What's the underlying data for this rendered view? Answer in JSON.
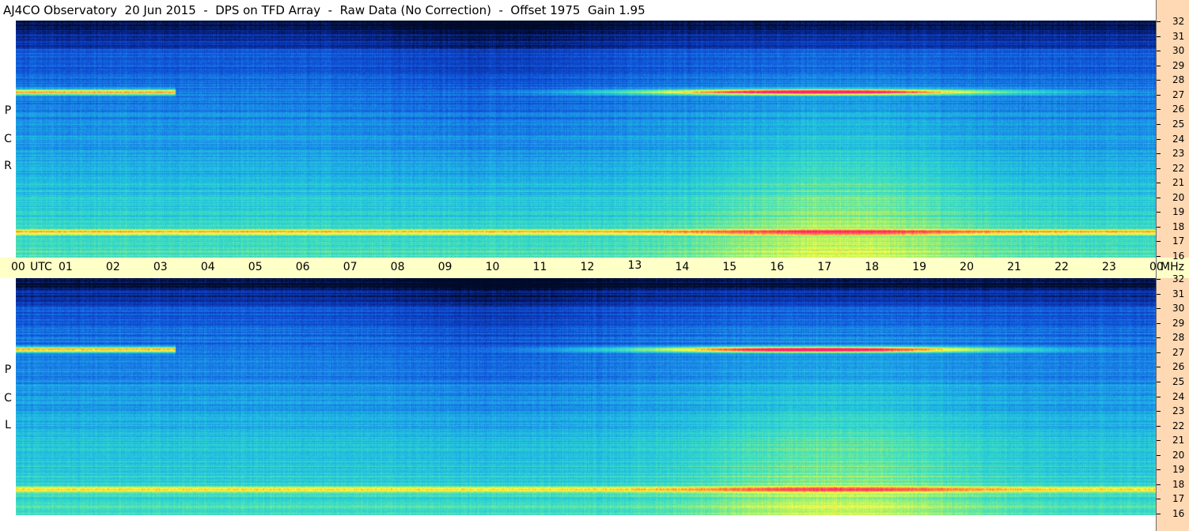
{
  "title": "AJ4CO Observatory  20 Jun 2015  -  DPS on TFD Array  -  Raw Data (No Correction)  -  Offset 1975  Gain 1.95",
  "panels": {
    "rcp": {
      "letters": [
        "R",
        "C",
        "P"
      ]
    },
    "lcp": {
      "letters": [
        "L",
        "C",
        "P"
      ]
    }
  },
  "time_axis": {
    "utc_label": "UTC",
    "mhz_label": "MHz",
    "hours": [
      "00",
      "01",
      "02",
      "03",
      "04",
      "05",
      "06",
      "07",
      "08",
      "09",
      "10",
      "11",
      "12",
      "13",
      "14",
      "15",
      "16",
      "17",
      "18",
      "19",
      "20",
      "21",
      "22",
      "23",
      "00"
    ]
  },
  "frequency_scale": {
    "ticks": [
      "32",
      "31",
      "30",
      "29",
      "28",
      "27",
      "26",
      "25",
      "24",
      "23",
      "22",
      "21",
      "20",
      "19",
      "18",
      "17",
      "16"
    ]
  },
  "colors": {
    "colormap": [
      "#000a28",
      "#0a2a9a",
      "#1050d8",
      "#1a8ae8",
      "#20c0e0",
      "#40e0c0",
      "#a0f070",
      "#ffff40",
      "#ff8040",
      "#ff2080"
    ],
    "scale_background": "#ffd9b3",
    "axis_background": "#ffffc8"
  }
}
